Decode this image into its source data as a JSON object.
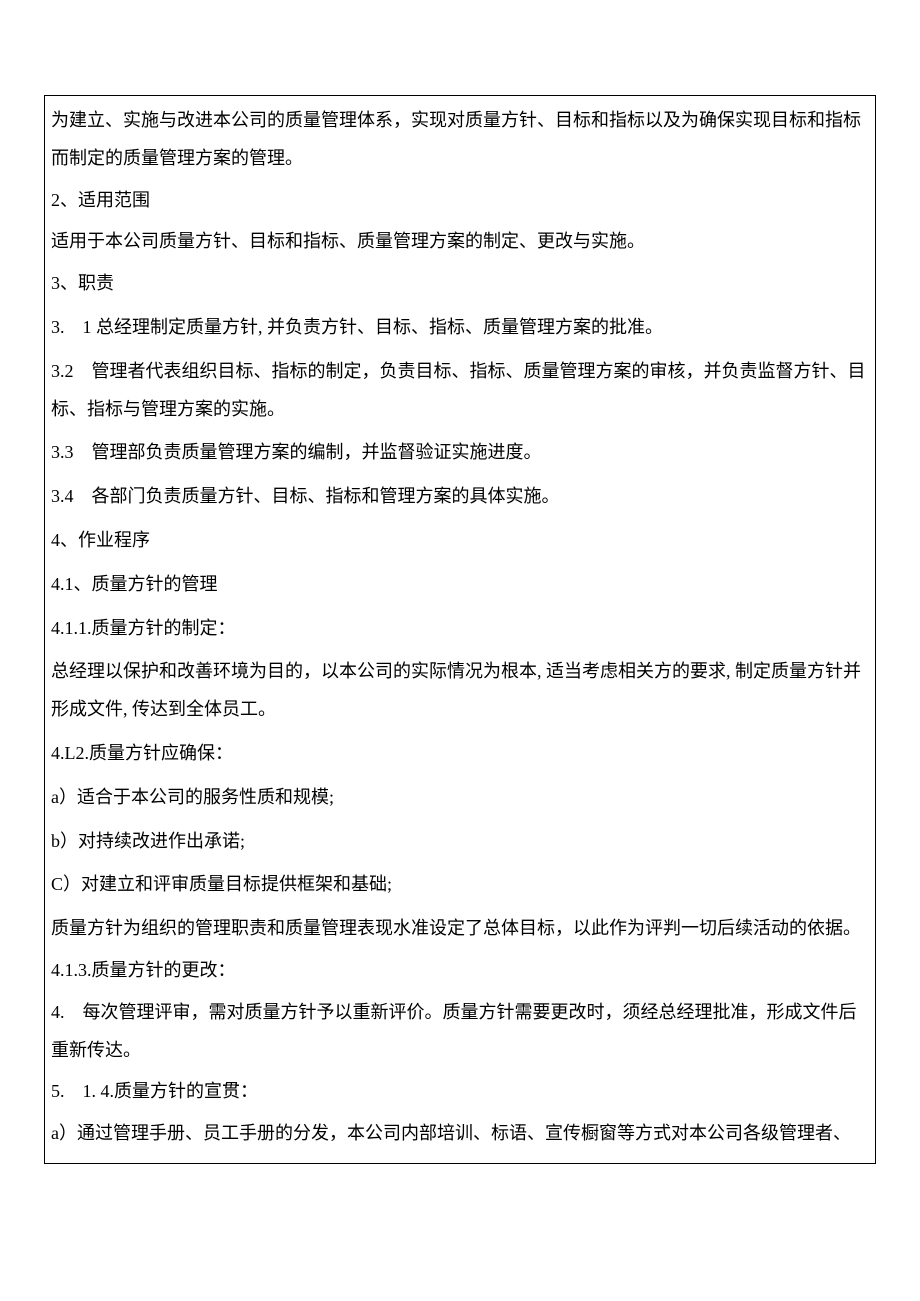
{
  "doc": {
    "p1": "为建立、实施与改进本公司的质量管理体系，实现对质量方针、目标和指标以及为确保实现目标和指标而制定的质量管理方案的管理。",
    "p2": "2、适用范围",
    "p3": "适用于本公司质量方针、目标和指标、质量管理方案的制定、更改与实施。",
    "p4": "3、职责",
    "p5": "3.　1 总经理制定质量方针, 并负责方针、目标、指标、质量管理方案的批准。",
    "p6": "3.2　管理者代表组织目标、指标的制定，负责目标、指标、质量管理方案的审核，并负责监督方针、目标、指标与管理方案的实施。",
    "p7": "3.3　管理部负责质量管理方案的编制，并监督验证实施进度。",
    "p8": "3.4　各部门负责质量方针、目标、指标和管理方案的具体实施。",
    "p9": "4、作业程序",
    "p10": "4.1、质量方针的管理",
    "p11": "4.1.1.质量方针的制定：",
    "p12": "总经理以保护和改善环境为目的，以本公司的实际情况为根本, 适当考虑相关方的要求, 制定质量方针并形成文件, 传达到全体员工。",
    "p13": "4.L2.质量方针应确保：",
    "p14": "a）适合于本公司的服务性质和规模;",
    "p15": "b）对持续改进作出承诺;",
    "p16": "C）对建立和评审质量目标提供框架和基础;",
    "p17": "质量方针为组织的管理职责和质量管理表现水准设定了总体目标，以此作为评判一切后续活动的依据。",
    "p18": "4.1.3.质量方针的更改：",
    "p19": "4.　每次管理评审，需对质量方针予以重新评价。质量方针需要更改时，须经总经理批准，形成文件后重新传达。",
    "p20": "5.　1. 4.质量方针的宣贯：",
    "p21": "a）通过管理手册、员工手册的分发，本公司内部培训、标语、宣传橱窗等方式对本公司各级管理者、"
  }
}
